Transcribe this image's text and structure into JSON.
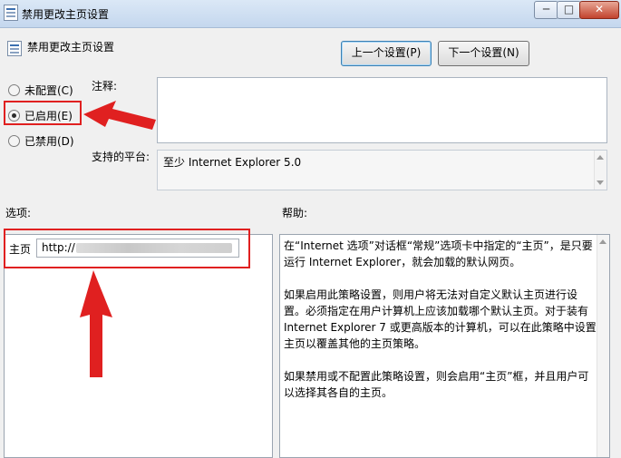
{
  "window": {
    "title": "禁用更改主页设置",
    "minimize": "─",
    "maximize": "□",
    "close": "✕"
  },
  "header": {
    "policy_title": "禁用更改主页设置",
    "prev_button": "上一个设置(P)",
    "next_button": "下一个设置(N)"
  },
  "state": {
    "options": [
      {
        "label": "未配置(C)",
        "selected": false
      },
      {
        "label": "已启用(E)",
        "selected": true
      },
      {
        "label": "已禁用(D)",
        "selected": false
      }
    ]
  },
  "comment": {
    "label": "注释:",
    "value": ""
  },
  "platform": {
    "label": "支持的平台:",
    "value": "至少 Internet Explorer 5.0"
  },
  "options_section": {
    "label": "选项:",
    "homepage_label": "主页",
    "homepage_value": "http://"
  },
  "help_section": {
    "label": "帮助:",
    "paragraphs": [
      "在“Internet 选项”对话框“常规”选项卡中指定的“主页”，是只要运行 Internet Explorer，就会加载的默认网页。",
      "如果启用此策略设置，则用户将无法对自定义默认主页进行设置。必须指定在用户计算机上应该加载哪个默认主页。对于装有 Internet Explorer 7 或更高版本的计算机，可以在此策略中设置主页以覆盖其他的主页策略。",
      "如果禁用或不配置此策略设置，则会启用“主页”框，并且用户可以选择其各自的主页。"
    ]
  },
  "colors": {
    "annotation": "#e02020",
    "window_bg": "#f0f0f0"
  },
  "icons": {
    "title_icon": "policy-icon",
    "policy_icon": "policy-icon"
  }
}
